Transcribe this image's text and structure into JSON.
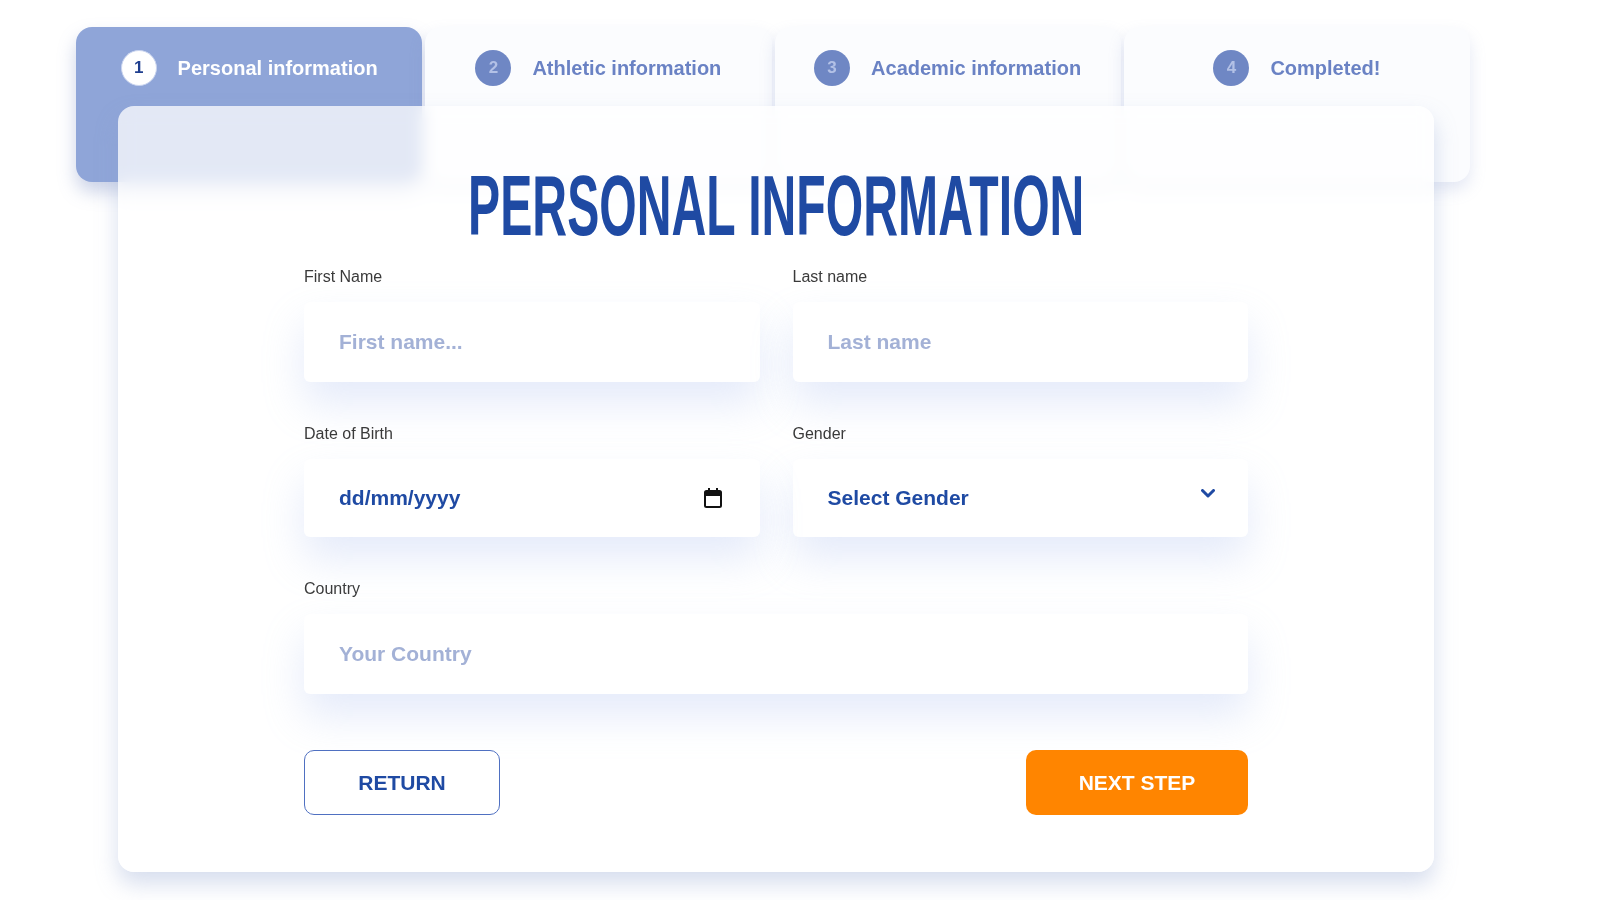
{
  "steps": [
    {
      "number": "1",
      "label": "Personal information",
      "selected": true
    },
    {
      "number": "2",
      "label": "Athletic information",
      "selected": false
    },
    {
      "number": "3",
      "label": "Academic information",
      "selected": false
    },
    {
      "number": "4",
      "label": "Completed!",
      "selected": false
    }
  ],
  "form": {
    "title": "PERSONAL INFORMATION",
    "rows": [
      [
        {
          "kind": "text",
          "label": "First Name",
          "placeholder": "First name..."
        },
        {
          "kind": "text",
          "label": "Last name",
          "placeholder": "Last name"
        }
      ],
      [
        {
          "kind": "date",
          "label": "Date of Birth",
          "placeholder": "dd/mm/yyyy"
        },
        {
          "kind": "select",
          "label": "Gender",
          "value": "Select Gender"
        }
      ],
      [
        {
          "kind": "text",
          "label": "Country",
          "placeholder": "Your Country"
        }
      ]
    ],
    "buttons": [
      {
        "kind": "outline",
        "label": "RETURN"
      },
      {
        "kind": "primary",
        "label": "NEXT STEP"
      }
    ]
  }
}
